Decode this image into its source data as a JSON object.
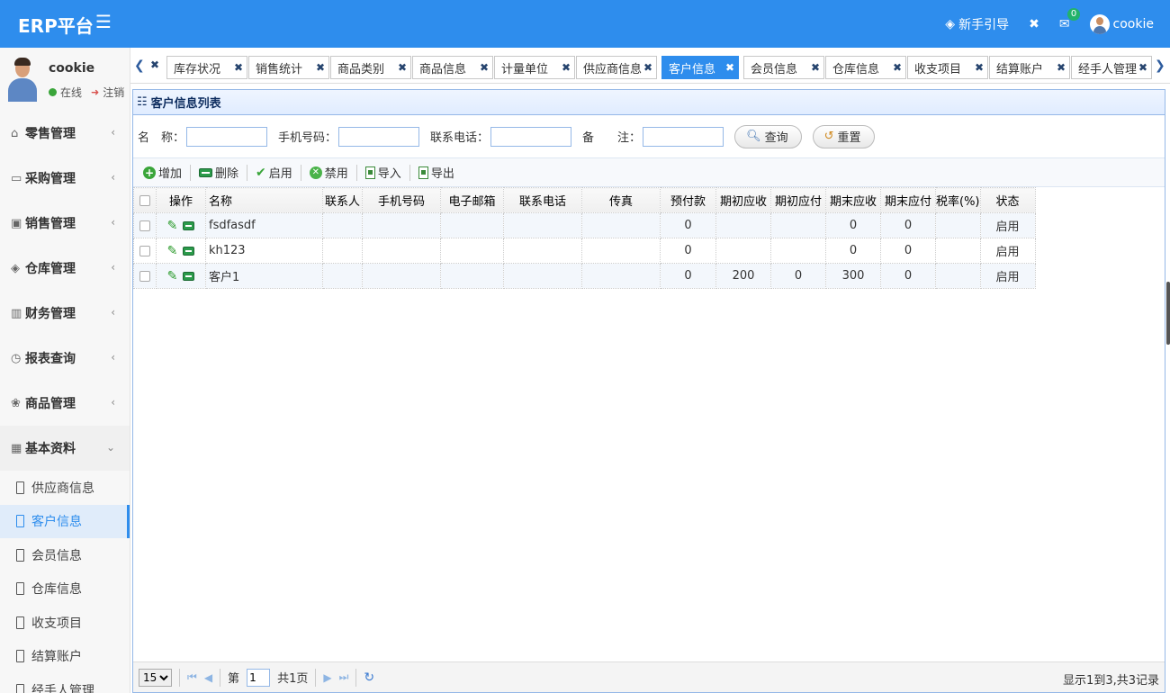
{
  "header": {
    "logo": "ERP平台",
    "guide": "新手引导",
    "notify_count": "0",
    "username": "cookie"
  },
  "user": {
    "name": "cookie",
    "status": "在线",
    "logout": "注销"
  },
  "nav": {
    "groups": [
      "零售管理",
      "采购管理",
      "销售管理",
      "仓库管理",
      "财务管理",
      "报表查询",
      "商品管理",
      "基本资料"
    ],
    "sub_items": [
      "供应商信息",
      "客户信息",
      "会员信息",
      "仓库信息",
      "收支项目",
      "结算账户",
      "经手人管理"
    ]
  },
  "tabs": [
    "库存状况",
    "销售统计",
    "商品类别",
    "商品信息",
    "计量单位",
    "供应商信息",
    "客户信息",
    "会员信息",
    "仓库信息",
    "收支项目",
    "结算账户",
    "经手人管理"
  ],
  "panel": {
    "title": "客户信息列表"
  },
  "search": {
    "name_label": "名　称：",
    "mobile_label": "手机号码：",
    "phone_label": "联系电话：",
    "remark_label": "备　　注：",
    "query_btn": "查询",
    "reset_btn": "重置"
  },
  "toolbar": {
    "add": "增加",
    "delete": "删除",
    "enable": "启用",
    "disable": "禁用",
    "import": "导入",
    "export": "导出"
  },
  "table": {
    "headers": [
      "操作",
      "名称",
      "联系人",
      "手机号码",
      "电子邮箱",
      "联系电话",
      "传真",
      "预付款",
      "期初应收",
      "期初应付",
      "期末应收",
      "期末应付",
      "税率(%)",
      "状态"
    ],
    "rows": [
      {
        "name": "fsdfasdf",
        "contact": "",
        "mobile": "",
        "email": "",
        "phone": "",
        "fax": "",
        "prepay": "0",
        "begin_recv": "",
        "begin_pay": "",
        "end_recv": "0",
        "end_pay": "0",
        "tax": "",
        "status": "启用"
      },
      {
        "name": "kh123",
        "contact": "",
        "mobile": "",
        "email": "",
        "phone": "",
        "fax": "",
        "prepay": "0",
        "begin_recv": "",
        "begin_pay": "",
        "end_recv": "0",
        "end_pay": "0",
        "tax": "",
        "status": "启用"
      },
      {
        "name": "客户1",
        "contact": "",
        "mobile": "",
        "email": "",
        "phone": "",
        "fax": "",
        "prepay": "0",
        "begin_recv": "200",
        "begin_pay": "0",
        "end_recv": "300",
        "end_pay": "0",
        "tax": "",
        "status": "启用"
      }
    ]
  },
  "pager": {
    "page_size": "15",
    "page_prefix": "第",
    "page_value": "1",
    "page_suffix": "共1页",
    "info": "显示1到3,共3记录"
  }
}
